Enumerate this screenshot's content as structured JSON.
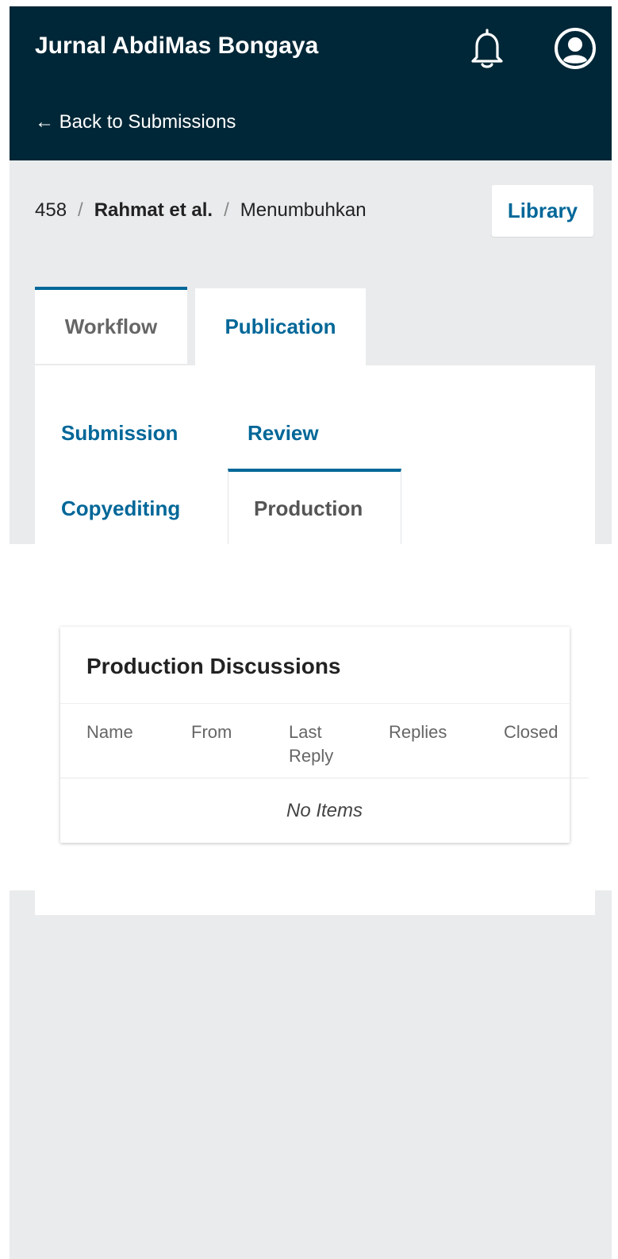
{
  "header": {
    "title": "Jurnal AbdiMas Bongaya",
    "back_link": "← Back to Submissions",
    "icons": {
      "notifications": "bell-icon",
      "user": "user-circle-icon"
    }
  },
  "breadcrumb": {
    "id": "458",
    "separator": "/",
    "authors": "Rahmat et al.",
    "title": "Menumbuhkan"
  },
  "library_button": "Library",
  "main_tabs": [
    {
      "label": "Workflow",
      "active": true
    },
    {
      "label": "Publication",
      "active": false
    }
  ],
  "stage_tabs": [
    {
      "label": "Submission",
      "active": false
    },
    {
      "label": "Review",
      "active": false
    },
    {
      "label": "Copyediting",
      "active": false
    },
    {
      "label": "Production",
      "active": true
    }
  ],
  "discussions": {
    "title": "Production Discussions",
    "columns": [
      "Name",
      "From",
      "Last Reply",
      "Replies",
      "Closed"
    ],
    "empty_text": "No Items"
  },
  "colors": {
    "header_bg": "#002737",
    "accent": "#006798",
    "page_bg": "#e9ebec"
  }
}
